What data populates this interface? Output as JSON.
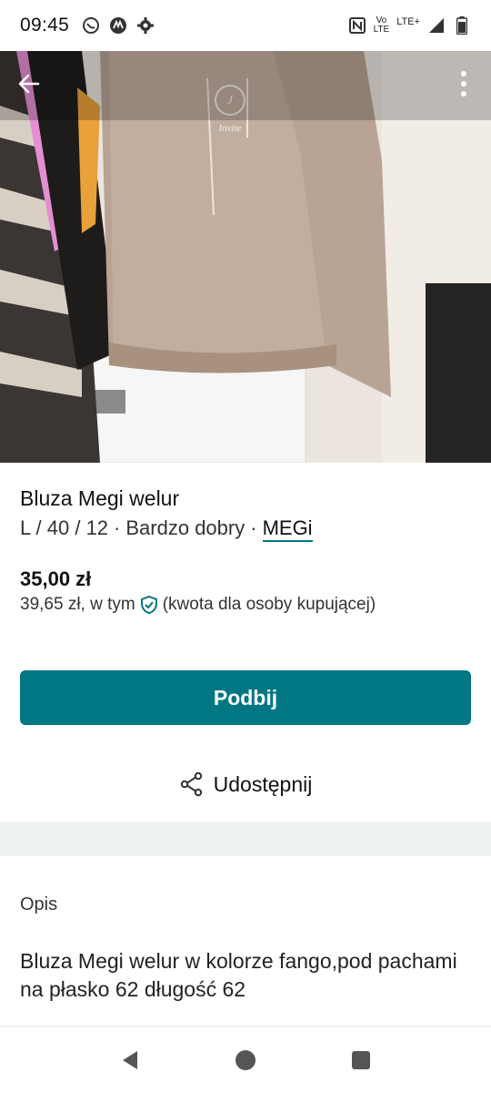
{
  "status_bar": {
    "time": "09:45",
    "volte_top": "Vo",
    "volte_bottom": "LTE",
    "lte": "LTE+",
    "icons": [
      "whatsapp-icon",
      "motorola-icon",
      "settings-icon",
      "nfc-icon",
      "signal-icon",
      "battery-icon"
    ]
  },
  "hero": {
    "icons": [
      "back-arrow-icon",
      "more-vertical-icon"
    ],
    "logo_text": "Invite"
  },
  "item": {
    "title": "Bluza Megi welur",
    "size": "L / 40 / 12",
    "separator1": "·",
    "condition": "Bardzo dobry",
    "separator2": "·",
    "brand": "MEGi",
    "price": "35,00 zł",
    "total_price": "39,65 zł, w tym",
    "total_note": "(kwota dla osoby kupującej)"
  },
  "actions": {
    "bump_label": "Podbij",
    "share_label": "Udostępnij"
  },
  "description": {
    "label": "Opis",
    "text": "Bluza Megi welur w kolorze fango,pod pachami na płasko 62 długość 62"
  },
  "colors": {
    "accent": "#007782",
    "band": "#eef2f2"
  }
}
